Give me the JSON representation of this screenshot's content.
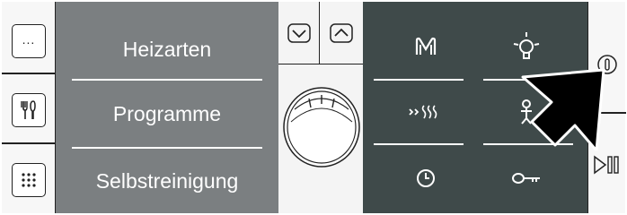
{
  "menu": {
    "items": [
      {
        "label": "Heizarten"
      },
      {
        "label": "Programme"
      },
      {
        "label": "Selbstreinigung"
      }
    ]
  },
  "left_buttons": [
    {
      "icon": "more-dots-icon"
    },
    {
      "icon": "cutlery-icon"
    },
    {
      "icon": "grid-dots-icon"
    }
  ],
  "nav": {
    "down_icon": "chevron-down-icon",
    "up_icon": "chevron-up-icon"
  },
  "dark_panel": {
    "buttons": [
      {
        "icon": "memory-m-icon"
      },
      {
        "icon": "oven-light-icon"
      },
      {
        "icon": "rapid-heat-icon"
      },
      {
        "icon": "child-lock-icon"
      },
      {
        "icon": "timer-clock-icon"
      },
      {
        "icon": "key-lock-icon"
      }
    ]
  },
  "right_buttons": [
    {
      "icon": "power-icon"
    },
    {
      "icon": "play-pause-icon"
    }
  ],
  "colors": {
    "menu_bg": "#7b7f81",
    "dark_bg": "#3f4a4a",
    "line": "#ffffff",
    "outline": "#222222"
  }
}
